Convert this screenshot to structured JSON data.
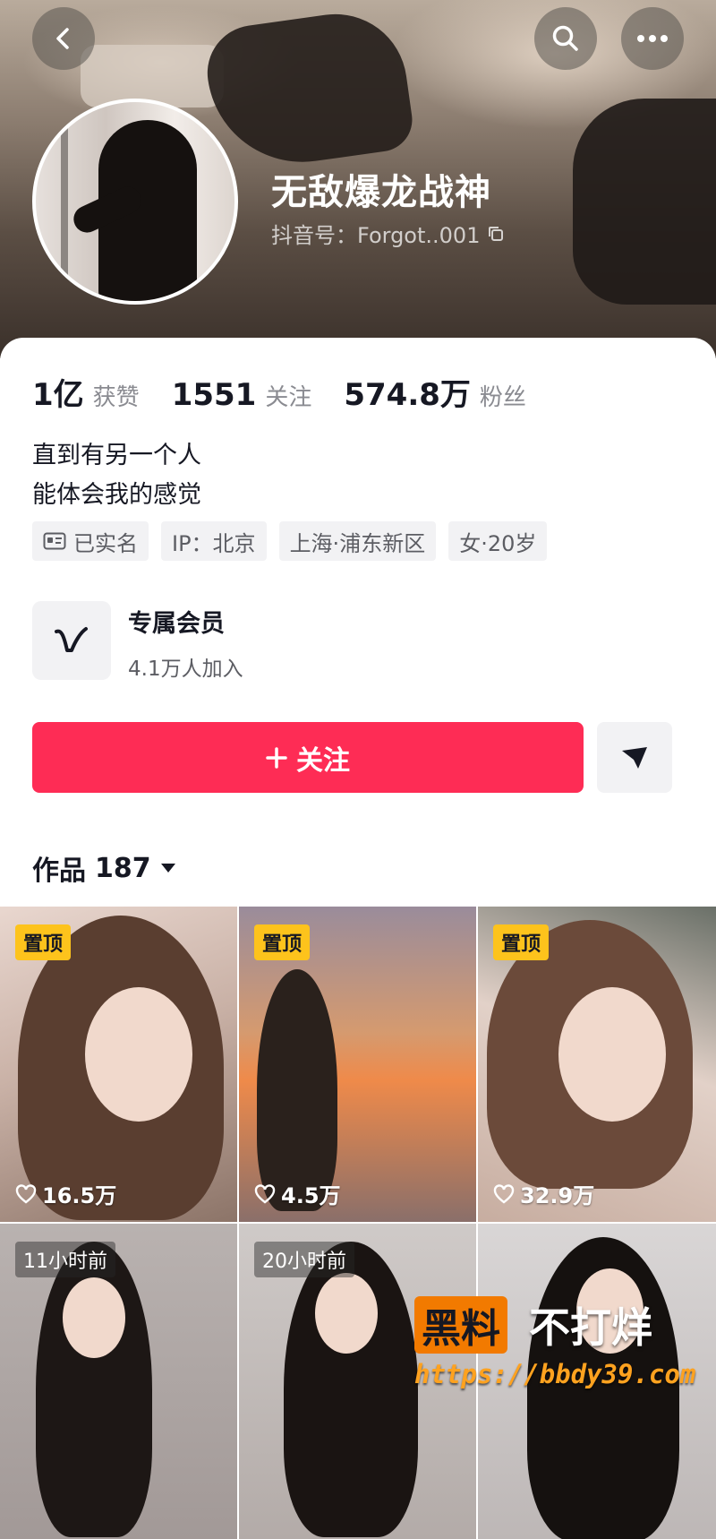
{
  "header": {
    "profile_name": "无敌爆龙战神",
    "douyin_id": "抖音号：Forgot..001",
    "back_icon": "chevron-left-icon",
    "search_icon": "search-icon",
    "more_icon": "more-dots-icon"
  },
  "stats": [
    {
      "value": "1亿",
      "label": "获赞"
    },
    {
      "value": "1551",
      "label": "关注"
    },
    {
      "value": "574.8万",
      "label": "粉丝"
    }
  ],
  "bio": [
    "直到有另一个人",
    "能体会我的感觉"
  ],
  "tags": [
    "已实名",
    "IP：北京",
    "上海·浦东新区",
    "女·20岁"
  ],
  "membership": {
    "title": "专属会员",
    "subtitle": "4.1万人加入"
  },
  "actions": {
    "follow_label": "关注"
  },
  "works_tab": {
    "label": "作品",
    "count": "187"
  },
  "videos": [
    {
      "badge": "置顶",
      "badge_type": "pin",
      "likes": "16.5万"
    },
    {
      "badge": "置顶",
      "badge_type": "pin",
      "likes": "4.5万"
    },
    {
      "badge": "置顶",
      "badge_type": "pin",
      "likes": "32.9万"
    },
    {
      "badge": "11小时前",
      "badge_type": "time",
      "likes": ""
    },
    {
      "badge": "20小时前",
      "badge_type": "time",
      "likes": ""
    },
    {
      "badge": "",
      "badge_type": "none",
      "likes": ""
    }
  ],
  "watermark": {
    "part1": "黑料",
    "part2": "不打烊",
    "url": "https://bbdy39.com"
  },
  "colors": {
    "accent": "#fe2c55",
    "pin_badge": "#fdc31c",
    "text": "#161823",
    "muted": "#8a8b91"
  }
}
